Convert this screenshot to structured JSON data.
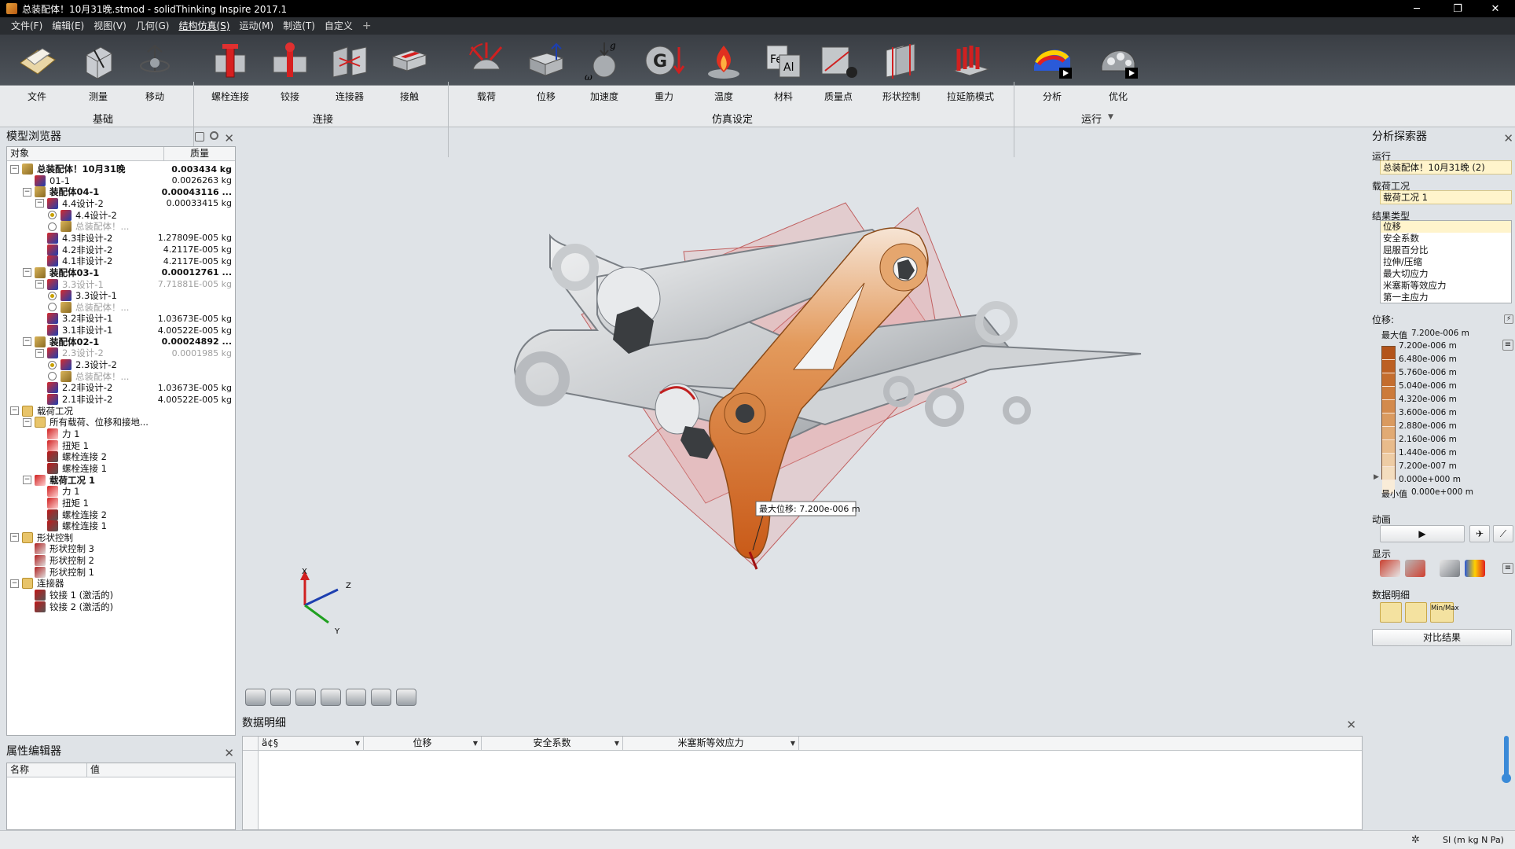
{
  "window": {
    "title": "总装配体！10月31晚.stmod - solidThinking Inspire 2017.1",
    "minimize": "─",
    "restore": "❐",
    "close": "✕"
  },
  "menu": [
    "文件(F)",
    "编辑(E)",
    "视图(V)",
    "几何(G)",
    "结构仿真(S)",
    "运动(M)",
    "制造(T)",
    "自定义"
  ],
  "menu_plus": "+",
  "ribbon": {
    "tools": [
      {
        "label": "文件",
        "icon": "file-icon"
      },
      {
        "label": "测量",
        "icon": "measure-icon"
      },
      {
        "label": "移动",
        "icon": "move-icon"
      },
      {
        "label": "螺栓连接",
        "icon": "bolt-icon"
      },
      {
        "label": "铰接",
        "icon": "joint-icon"
      },
      {
        "label": "连接器",
        "icon": "connector-icon"
      },
      {
        "label": "接触",
        "icon": "contact-icon"
      },
      {
        "label": "载荷",
        "icon": "load-icon"
      },
      {
        "label": "位移",
        "icon": "displacement-icon"
      },
      {
        "label": "加速度",
        "icon": "acceleration-icon"
      },
      {
        "label": "重力",
        "icon": "gravity-icon"
      },
      {
        "label": "温度",
        "icon": "temperature-icon"
      },
      {
        "label": "材料",
        "icon": "material-icon"
      },
      {
        "label": "质量点",
        "icon": "mass-point-icon"
      },
      {
        "label": "形状控制",
        "icon": "shape-control-icon"
      },
      {
        "label": "拉延筋模式",
        "icon": "draw-bead-icon"
      },
      {
        "label": "分析",
        "icon": "analyze-icon"
      },
      {
        "label": "优化",
        "icon": "optimize-icon"
      }
    ],
    "groups": [
      "基础",
      "连接",
      "仿真设定",
      "运行"
    ],
    "accel_g": "g",
    "accel_omega": "ω",
    "gravity_letter": "G",
    "material_fe": "Fe",
    "material_al": "Al",
    "run_dropdown": "▼"
  },
  "model_browser": {
    "title": "模型浏览器",
    "col_object": "对象",
    "col_mass": "质量",
    "rows": [
      {
        "name": "总装配体！10月31晚",
        "mass": "0.003434 kg"
      },
      {
        "name": "01-1",
        "mass": "0.0026263 kg"
      },
      {
        "name": "装配体04-1",
        "mass": "0.00043116 ..."
      },
      {
        "name": "4.4设计-2",
        "mass": "0.00033415 kg"
      },
      {
        "name": "4.4设计-2",
        "mass": ""
      },
      {
        "name": "总装配体！...",
        "mass": ""
      },
      {
        "name": "4.3非设计-2",
        "mass": "1.27809E-005 kg"
      },
      {
        "name": "4.2非设计-2",
        "mass": "4.2117E-005 kg"
      },
      {
        "name": "4.1非设计-2",
        "mass": "4.2117E-005 kg"
      },
      {
        "name": "装配体03-1",
        "mass": "0.00012761 ..."
      },
      {
        "name": "3.3设计-1",
        "mass": "7.71881E-005 kg"
      },
      {
        "name": "3.3设计-1",
        "mass": ""
      },
      {
        "name": "总装配体！...",
        "mass": ""
      },
      {
        "name": "3.2非设计-1",
        "mass": "1.03673E-005 kg"
      },
      {
        "name": "3.1非设计-1",
        "mass": "4.00522E-005 kg"
      },
      {
        "name": "装配体02-1",
        "mass": "0.00024892 ..."
      },
      {
        "name": "2.3设计-2",
        "mass": "0.0001985 kg"
      },
      {
        "name": "2.3设计-2",
        "mass": ""
      },
      {
        "name": "总装配体！...",
        "mass": ""
      },
      {
        "name": "2.2非设计-2",
        "mass": "1.03673E-005 kg"
      },
      {
        "name": "2.1非设计-2",
        "mass": "4.00522E-005 kg"
      },
      {
        "name": "载荷工况",
        "mass": ""
      },
      {
        "name": "所有载荷、位移和接地...",
        "mass": ""
      },
      {
        "name": "力 1",
        "mass": ""
      },
      {
        "name": "扭矩 1",
        "mass": ""
      },
      {
        "name": "螺栓连接 2",
        "mass": ""
      },
      {
        "name": "螺栓连接 1",
        "mass": ""
      },
      {
        "name": "载荷工况 1",
        "mass": ""
      },
      {
        "name": "力 1",
        "mass": ""
      },
      {
        "name": "扭矩 1",
        "mass": ""
      },
      {
        "name": "螺栓连接 2",
        "mass": ""
      },
      {
        "name": "螺栓连接 1",
        "mass": ""
      },
      {
        "name": "形状控制",
        "mass": ""
      },
      {
        "name": "形状控制 3",
        "mass": ""
      },
      {
        "name": "形状控制 2",
        "mass": ""
      },
      {
        "name": "形状控制 1",
        "mass": ""
      },
      {
        "name": "连接器",
        "mass": ""
      },
      {
        "name": "铰接 1 (激活的)",
        "mass": ""
      },
      {
        "name": "铰接 2 (激活的)",
        "mass": ""
      }
    ]
  },
  "property_editor": {
    "title": "属性编辑器",
    "col_name": "名称",
    "col_value": "值"
  },
  "viewport": {
    "max_label": "最大位移: 7.200e-006 m",
    "axis_x": "X",
    "axis_y": "Y",
    "axis_z": "Z"
  },
  "data_detail": {
    "title": "数据明细",
    "columns": [
      "ä¢§",
      "位移",
      "安全系数",
      "米塞斯等效应力"
    ]
  },
  "analysis_explorer": {
    "title": "分析探索器",
    "run_label": "运行",
    "run_value": "总装配体！10月31晚 (2)",
    "loadcase_label": "载荷工况",
    "loadcase_value": "载荷工况 1",
    "result_type_label": "结果类型",
    "result_types": [
      "位移",
      "安全系数",
      "屈服百分比",
      "拉伸/压缩",
      "最大切应力",
      "米塞斯等效应力",
      "第一主应力"
    ],
    "result_selected": "位移",
    "legend_title": "位移:",
    "legend_max_label": "最大值",
    "legend_max_value": "7.200e-006 m",
    "legend_min_label": "最小值",
    "legend_min_value": "0.000e+000 m",
    "legend_values": [
      "7.200e-006 m",
      "6.480e-006 m",
      "5.760e-006 m",
      "5.040e-006 m",
      "4.320e-006 m",
      "3.600e-006 m",
      "2.880e-006 m",
      "2.160e-006 m",
      "1.440e-006 m",
      "7.200e-007 m",
      "0.000e+000 m"
    ],
    "legend_colors": [
      "#b3541b",
      "#bc6023",
      "#c46d2e",
      "#cc7b3b",
      "#d38a4c",
      "#da9a5f",
      "#e1aa74",
      "#e8bb8b",
      "#eecca4",
      "#f4ddbe",
      "#f9ecd8"
    ],
    "animation_label": "动画",
    "play": "▶",
    "display_label": "显示",
    "data_detail_label": "数据明细",
    "minmax": "Min/Max",
    "compare_button": "对比结果",
    "menu_glyph": "≡"
  },
  "status": {
    "units": "SI (m kg N Pa)"
  },
  "colors": {
    "accent_orange": "#d9772f",
    "highlight_yellow": "#fff4cc",
    "title_bg": "#000000"
  }
}
